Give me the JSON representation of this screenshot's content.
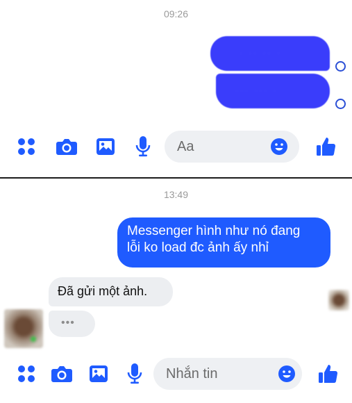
{
  "top_panel": {
    "timestamp": "09:26",
    "composer_placeholder": "Aa"
  },
  "bottom_panel": {
    "timestamp": "13:49",
    "outgoing_message": {
      "line1": "Messenger hình như nó đang",
      "line2": "lỗi ko load đc ảnh ấy nhỉ"
    },
    "incoming_message": "Đã gửi một ảnh.",
    "typing_dots": "•••",
    "composer_placeholder": "Nhắn tin"
  },
  "colors": {
    "accent": "#1f5bff",
    "incoming_bubble": "#eceef1",
    "icon_blue": "#1f5bff"
  },
  "icons": [
    "apps-icon",
    "camera-icon",
    "image-icon",
    "microphone-icon",
    "emoji-icon",
    "thumbs-up-icon",
    "sent-status-icon"
  ]
}
